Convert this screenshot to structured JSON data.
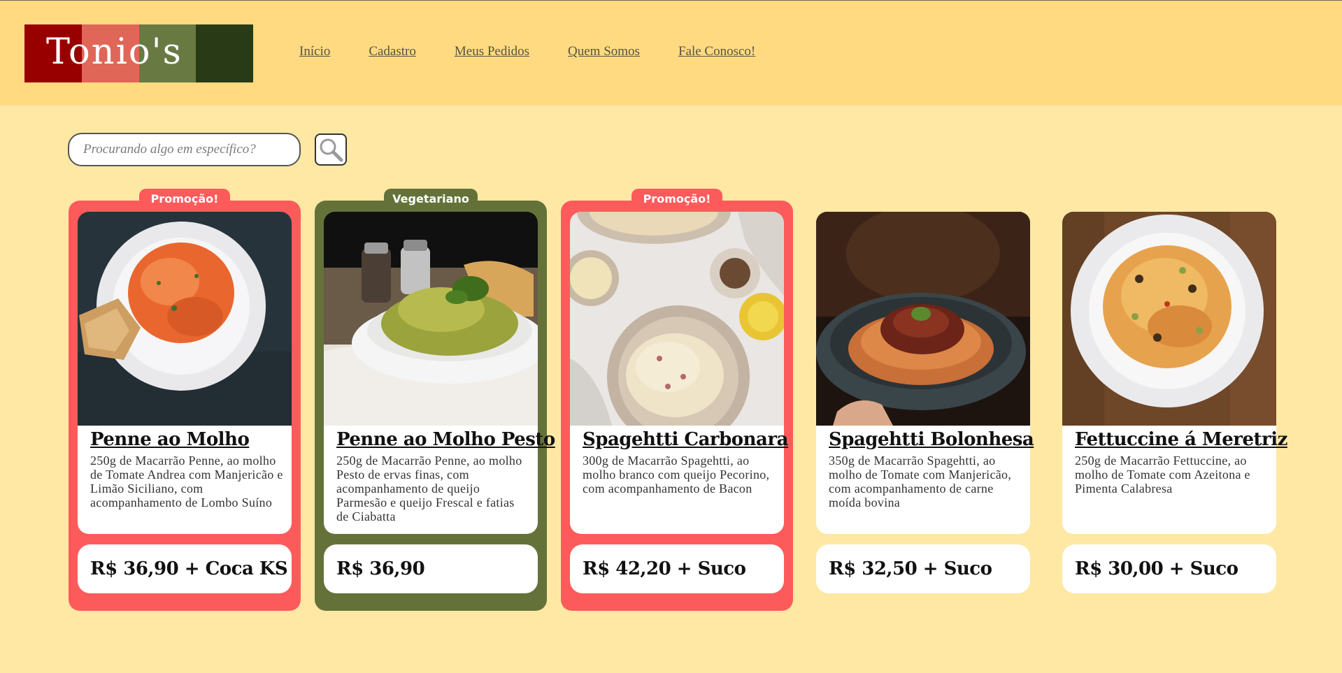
{
  "brand": {
    "name": "Tonio's",
    "stripe_colors": [
      "#980000",
      "#e06658",
      "#687a42",
      "#283a16"
    ]
  },
  "nav": {
    "items": [
      {
        "label": "Início"
      },
      {
        "label": "Cadastro"
      },
      {
        "label": "Meus Pedidos"
      },
      {
        "label": "Quem Somos"
      },
      {
        "label": "Fale Conosco!"
      }
    ]
  },
  "search": {
    "placeholder": "Procurando algo em específico?",
    "button_icon": "search-icon"
  },
  "colors": {
    "header_bg": "#ffda81",
    "page_bg": "#ffe8a4",
    "promo": "#fd5b5b",
    "vegetarian": "#647239"
  },
  "products": [
    {
      "badge": "Promoção!",
      "badge_color": "#fd5b5b",
      "name": "Penne ao Molho",
      "description": "250g de Macarrão Penne, ao molho de Tomate Andrea com Manjericão e Limão Siciliano, com acompanhamento de Lombo Suíno",
      "price": "R$ 36,90",
      "extra": "+ Coca KS"
    },
    {
      "badge": "Vegetariano",
      "badge_color": "#647239",
      "name": "Penne ao Molho Pesto",
      "description": "250g de Macarrão Penne, ao molho Pesto de ervas finas, com acompanhamento de queijo Parmesão e queijo Frescal e fatias de Ciabatta",
      "price": "R$ 36,90",
      "extra": ""
    },
    {
      "badge": "Promoção!",
      "badge_color": "#fd5b5b",
      "name": "Spagehtti Carbonara",
      "description": "300g de Macarrão Spagehtti, ao molho branco com queijo Pecorino, com acompanhamento de Bacon",
      "price": "R$ 42,20",
      "extra": "+ Suco"
    },
    {
      "badge": "",
      "badge_color": "",
      "name": "Spagehtti Bolonhesa",
      "description": "350g de Macarrão Spagehtti, ao molho de Tomate com Manjericão, com acompanhamento de carne moída bovina",
      "price": "R$ 32,50",
      "extra": "+ Suco"
    },
    {
      "badge": "",
      "badge_color": "",
      "name": "Fettuccine á Meretriz",
      "description": "250g de Macarrão Fettuccine, ao molho de Tomate com Azeitona e Pimenta Calabresa",
      "price": "R$ 30,00",
      "extra": "+ Suco"
    }
  ]
}
